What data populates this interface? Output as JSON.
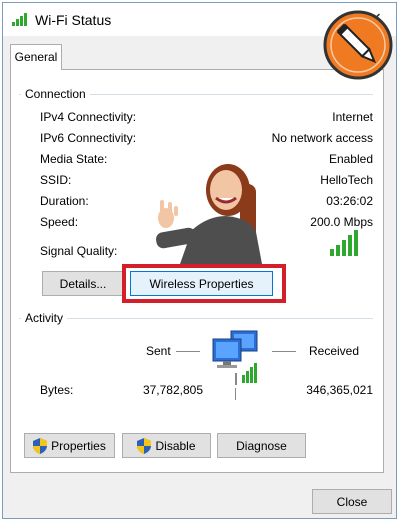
{
  "window": {
    "title": "Wi-Fi Status",
    "close_glyph": "✕",
    "title_icon": "wifi-signal-icon"
  },
  "tabs": [
    {
      "label": "General"
    }
  ],
  "connection": {
    "section_label": "Connection",
    "rows": [
      {
        "label": "IPv4 Connectivity:",
        "value": "Internet"
      },
      {
        "label": "IPv6 Connectivity:",
        "value": "No network access"
      },
      {
        "label": "Media State:",
        "value": "Enabled"
      },
      {
        "label": "SSID:",
        "value": "HelloTech"
      },
      {
        "label": "Duration:",
        "value": "03:26:02"
      },
      {
        "label": "Speed:",
        "value": "200.0 Mbps"
      }
    ],
    "signal_quality_label": "Signal Quality:",
    "signal_bars": 5
  },
  "buttons": {
    "details": "Details...",
    "wireless_properties": "Wireless Properties",
    "properties": "Properties",
    "disable": "Disable",
    "diagnose": "Diagnose",
    "close": "Close"
  },
  "activity": {
    "section_label": "Activity",
    "sent_label": "Sent",
    "received_label": "Received",
    "bytes_label": "Bytes:",
    "bytes_sent": "37,782,805",
    "bytes_received": "346,365,021"
  },
  "colors": {
    "highlight": "#d21f2a",
    "signal_green": "#2fa82f",
    "badge_orange": "#f07a22"
  }
}
